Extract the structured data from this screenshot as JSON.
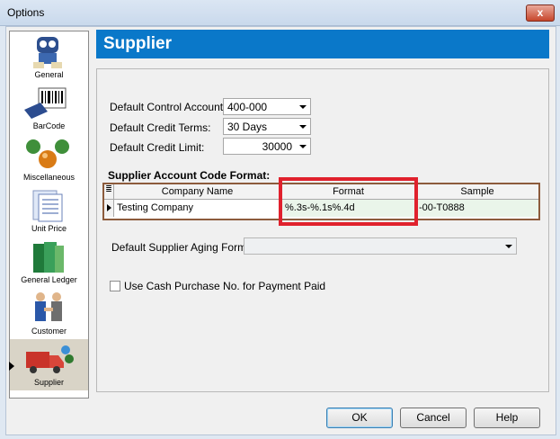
{
  "window": {
    "title": "Options",
    "close_glyph": "x"
  },
  "sidebar": {
    "items": [
      {
        "label": "General",
        "icon": "robot-icon"
      },
      {
        "label": "BarCode",
        "icon": "barcode-scanner-icon"
      },
      {
        "label": "Miscellaneous",
        "icon": "spheres-icon"
      },
      {
        "label": "Unit Price",
        "icon": "price-list-icon"
      },
      {
        "label": "General Ledger",
        "icon": "ledger-books-icon"
      },
      {
        "label": "Customer",
        "icon": "customer-handshake-icon"
      },
      {
        "label": "Supplier",
        "icon": "supplier-truck-icon"
      }
    ],
    "selected": "Supplier"
  },
  "header": {
    "title": "Supplier"
  },
  "form": {
    "control_account_label": "Default Control Account:",
    "control_account_value": "400-000",
    "credit_terms_label": "Default Credit Terms:",
    "credit_terms_value": "30 Days",
    "credit_limit_label": "Default Credit Limit:",
    "credit_limit_value": "30000",
    "code_format_title": "Supplier Account Code Format:",
    "aging_format_label": "Default Supplier Aging Format:",
    "aging_format_value": "",
    "cash_purchase_label": "Use Cash Purchase No. for Payment Paid",
    "cash_purchase_checked": false
  },
  "grid": {
    "corner_glyph": "≣",
    "columns": [
      "Company Name",
      "Format",
      "Sample"
    ],
    "rows": [
      {
        "company": "Testing Company",
        "format": "%.3s-%.1s%.4d",
        "sample": "-00-T0888"
      }
    ]
  },
  "buttons": {
    "ok": "OK",
    "cancel": "Cancel",
    "help": "Help"
  },
  "colors": {
    "header_bg": "#0a78c9",
    "highlight": "#e0212d",
    "grid_border": "#8c5b3c"
  }
}
